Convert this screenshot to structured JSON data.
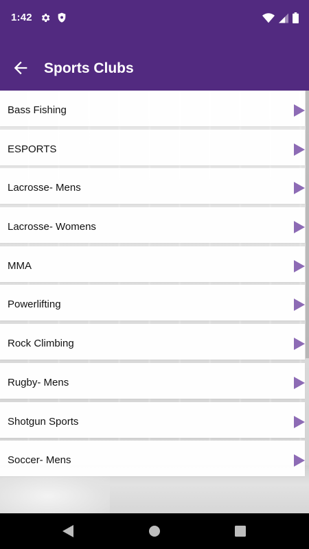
{
  "status_bar": {
    "time": "1:42",
    "icons_left": [
      "gear-icon",
      "shield-icon"
    ],
    "icons_right": [
      "wifi-icon",
      "cellular-signal-icon",
      "battery-icon"
    ]
  },
  "app_bar": {
    "title": "Sports Clubs",
    "back_icon": "arrow-left-icon",
    "background_color": "#522a80"
  },
  "clubs": [
    {
      "label": "Bass Fishing"
    },
    {
      "label": "ESPORTS"
    },
    {
      "label": "Lacrosse- Mens"
    },
    {
      "label": "Lacrosse- Womens"
    },
    {
      "label": "MMA"
    },
    {
      "label": "Powerlifting"
    },
    {
      "label": "Rock Climbing"
    },
    {
      "label": "Rugby- Mens"
    },
    {
      "label": "Shotgun Sports"
    },
    {
      "label": "Soccer- Mens"
    }
  ],
  "colors": {
    "accent": "#8d6bb5",
    "header": "#522a80"
  },
  "nav_bar": {
    "buttons": [
      "back-triangle-icon",
      "home-circle-icon",
      "recents-square-icon"
    ]
  }
}
